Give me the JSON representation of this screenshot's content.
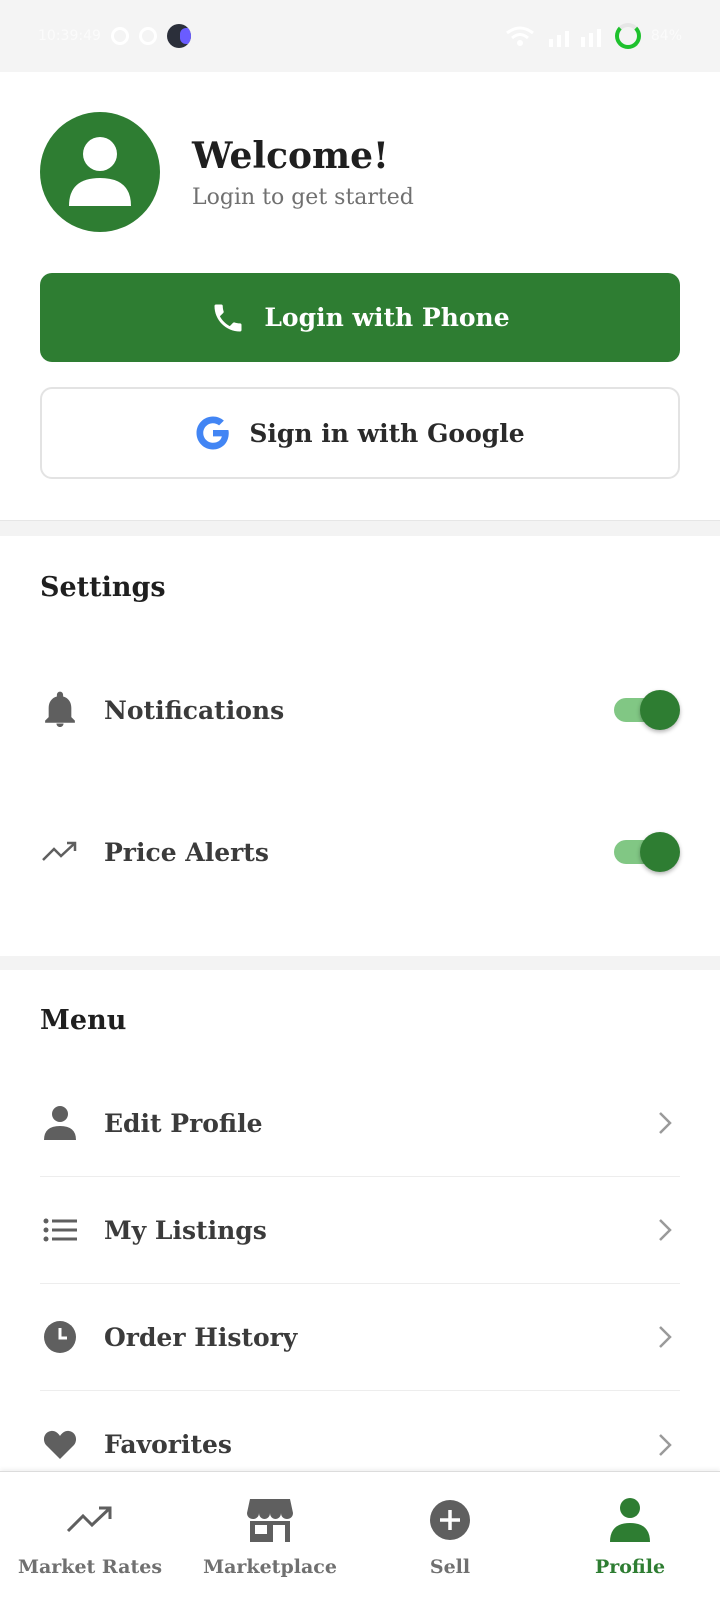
{
  "status_bar": {
    "time": "10:39:49",
    "battery": "84%"
  },
  "profile": {
    "title": "Welcome!",
    "subtitle": "Login to get started",
    "avatar_icon": "user-icon"
  },
  "auth": {
    "phone_label": "Login with Phone",
    "google_label": "Sign in with Google"
  },
  "settings": {
    "title": "Settings",
    "items": [
      {
        "label": "Notifications",
        "icon": "bell-icon",
        "enabled": true
      },
      {
        "label": "Price Alerts",
        "icon": "trending-up-icon",
        "enabled": true
      }
    ]
  },
  "menu": {
    "title": "Menu",
    "items": [
      {
        "label": "Edit Profile",
        "icon": "person-icon"
      },
      {
        "label": "My Listings",
        "icon": "list-icon"
      },
      {
        "label": "Order History",
        "icon": "clock-icon"
      },
      {
        "label": "Favorites",
        "icon": "heart-icon"
      }
    ]
  },
  "bottom_nav": {
    "items": [
      {
        "label": "Market Rates",
        "icon": "trending-up-icon",
        "active": false
      },
      {
        "label": "Marketplace",
        "icon": "store-icon",
        "active": false
      },
      {
        "label": "Sell",
        "icon": "add-circle-icon",
        "active": false
      },
      {
        "label": "Profile",
        "icon": "person-icon",
        "active": true
      }
    ]
  },
  "colors": {
    "primary": "#2e7d32",
    "toggle_track": "#81c784",
    "muted_text": "#707070",
    "icon_grey": "#555555"
  }
}
